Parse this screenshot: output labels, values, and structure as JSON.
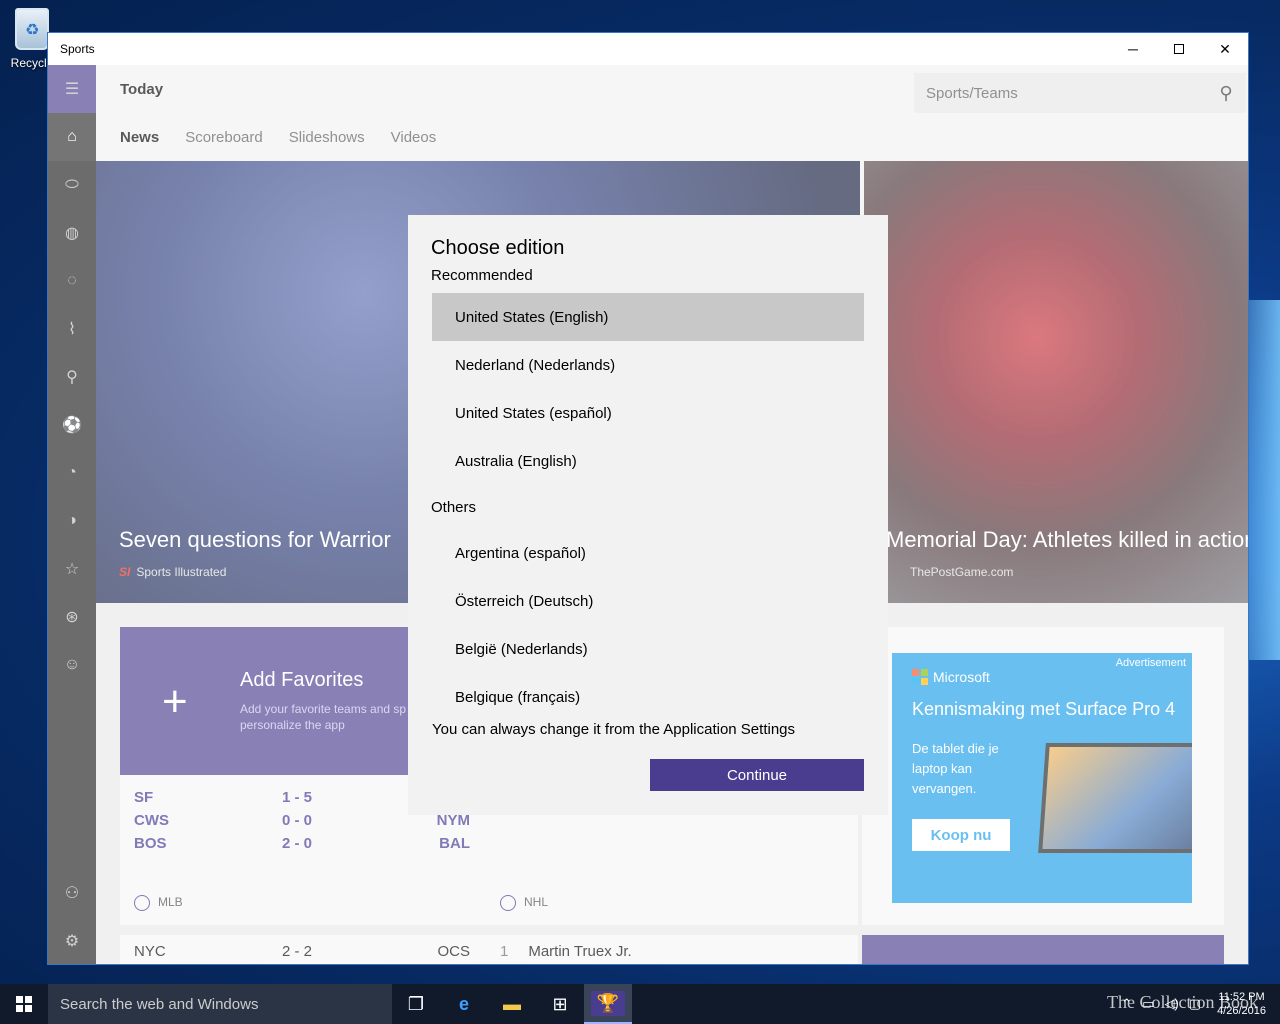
{
  "desktop": {
    "recycle_label": "Recycle"
  },
  "window": {
    "title": "Sports"
  },
  "header": {
    "page_title": "Today",
    "search_placeholder": "Sports/Teams"
  },
  "tabs": [
    {
      "label": "News"
    },
    {
      "label": "Scoreboard"
    },
    {
      "label": "Slideshows"
    },
    {
      "label": "Videos"
    }
  ],
  "hero": {
    "left": {
      "headline": "Seven questions for Warrior",
      "source_logo": "SI",
      "source": "Sports Illustrated"
    },
    "right": {
      "headline": "Memorial Day: Athletes killed in action",
      "source": "ThePostGame.com"
    }
  },
  "favorites": {
    "title": "Add Favorites",
    "subtitle": "Add your favorite teams and sp",
    "subtitle2": "personalize the app"
  },
  "scores": {
    "mlb": [
      {
        "team1": "SF",
        "score": "1 - 5",
        "team2": ""
      },
      {
        "team1": "CWS",
        "score": "0 - 0",
        "team2": "NYM"
      },
      {
        "team1": "BOS",
        "score": "2 - 0",
        "team2": "BAL"
      }
    ],
    "mlb_league": "MLB",
    "nhl_league": "NHL",
    "next_row": {
      "team1": "NYC",
      "score": "2 - 2",
      "team2": "OCS"
    },
    "nascar_row": {
      "rank": "1",
      "name": "Martin Truex Jr."
    }
  },
  "ad": {
    "label": "Advertisement",
    "brand": "Microsoft",
    "headline": "Kennismaking met Surface Pro 4",
    "body": "De tablet die je laptop kan vervangen.",
    "cta": "Koop nu"
  },
  "dialog": {
    "title": "Choose edition",
    "recommended_label": "Recommended",
    "recommended": [
      {
        "label": "United States (English)"
      },
      {
        "label": "Nederland (Nederlands)"
      },
      {
        "label": "United States (español)"
      },
      {
        "label": "Australia (English)"
      }
    ],
    "others_label": "Others",
    "others": [
      {
        "label": "Argentina (español)"
      },
      {
        "label": "Österreich (Deutsch)"
      },
      {
        "label": "België (Nederlands)"
      },
      {
        "label": "Belgique (français)"
      }
    ],
    "note": "You can always change it from the Application Settings",
    "continue": "Continue"
  },
  "taskbar": {
    "search_placeholder": "Search the web and Windows",
    "time": "11:52 PM",
    "date": "4/26/2016",
    "watermark": "The Collection Book"
  },
  "colors": {
    "accent": "#4a3d8f",
    "selected": "#c8c8c8",
    "ad_blue": "#1a9ee8"
  }
}
